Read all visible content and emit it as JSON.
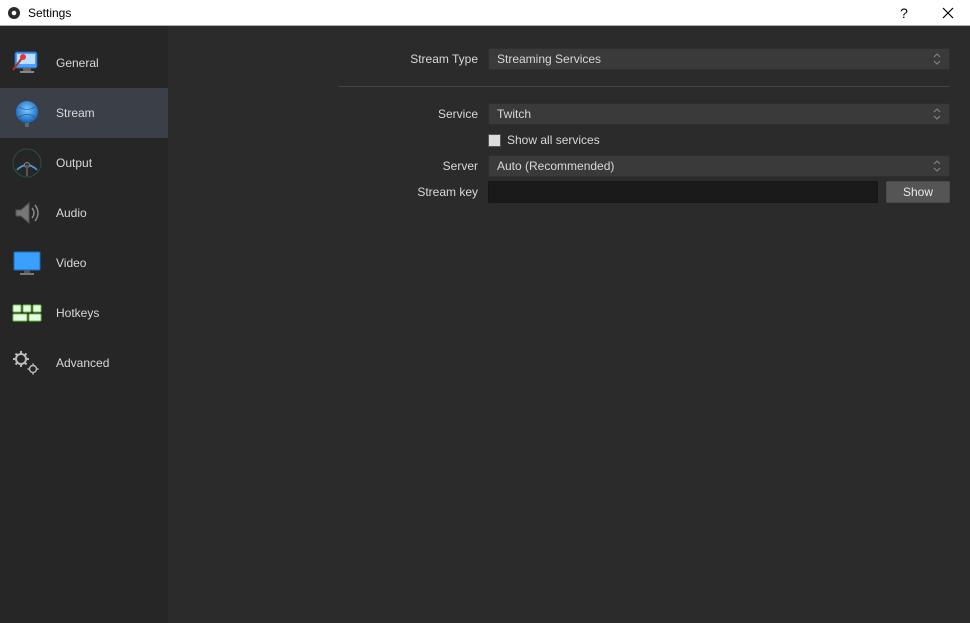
{
  "window": {
    "title": "Settings"
  },
  "sidebar": {
    "items": [
      {
        "label": "General",
        "icon": "general-icon"
      },
      {
        "label": "Stream",
        "icon": "stream-icon"
      },
      {
        "label": "Output",
        "icon": "output-icon"
      },
      {
        "label": "Audio",
        "icon": "audio-icon"
      },
      {
        "label": "Video",
        "icon": "video-icon"
      },
      {
        "label": "Hotkeys",
        "icon": "hotkeys-icon"
      },
      {
        "label": "Advanced",
        "icon": "advanced-icon"
      }
    ],
    "active_index": 1
  },
  "form": {
    "stream_type_label": "Stream Type",
    "stream_type_value": "Streaming Services",
    "service_label": "Service",
    "service_value": "Twitch",
    "show_all_label": "Show all services",
    "show_all_checked": false,
    "server_label": "Server",
    "server_value": "Auto (Recommended)",
    "stream_key_label": "Stream key",
    "stream_key_value": "",
    "show_button_label": "Show"
  }
}
